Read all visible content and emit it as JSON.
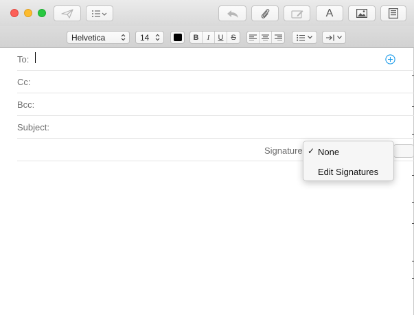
{
  "window": {
    "traffic_lights": [
      "close",
      "minimize",
      "zoom"
    ]
  },
  "toolbar": {
    "buttons": [
      "send-icon",
      "header-fields-icon",
      "reply-icon",
      "attachment-icon",
      "markup-icon",
      "format-icon",
      "photo-browser-icon",
      "stationery-icon"
    ],
    "format_glyph": "A"
  },
  "format_bar": {
    "font": "Helvetica",
    "size": "14",
    "text_color": "#000000",
    "style_buttons": [
      "B",
      "I",
      "U",
      "S"
    ],
    "align_buttons": [
      "align-left-icon",
      "align-center-icon",
      "align-right-icon"
    ],
    "list_icon": "list-icon",
    "indent_icon": "indent-icon"
  },
  "header_fields": {
    "to_label": "To:",
    "cc_label": "Cc:",
    "bcc_label": "Bcc:",
    "subject_label": "Subject:",
    "add_contact_icon": "plus-circle-icon",
    "accent": "#1a9bea"
  },
  "signature": {
    "label": "Signature",
    "menu": {
      "items": [
        {
          "label": "None",
          "checked": true
        },
        {
          "label": "Edit Signatures",
          "checked": false
        }
      ],
      "check_glyph": "✓"
    }
  }
}
